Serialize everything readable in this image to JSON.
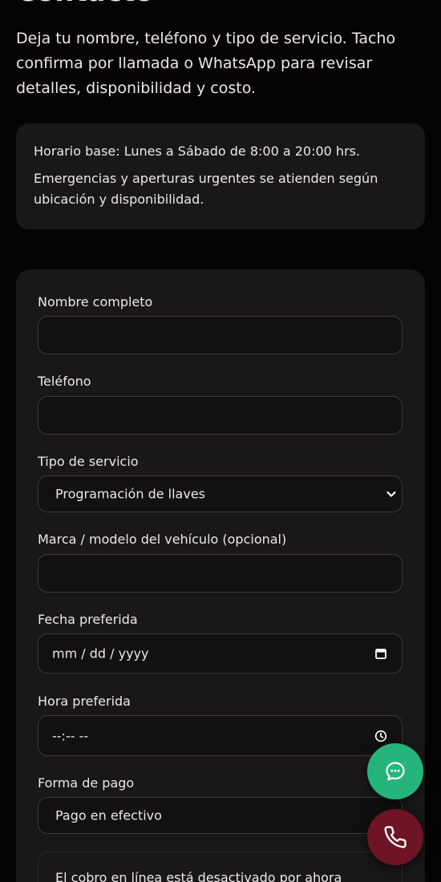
{
  "page": {
    "heading_fragment": "Contacto",
    "intro": "Deja tu nombre, teléfono y tipo de servicio. Tacho confirma por llamada o WhatsApp para revisar detalles, disponibilidad y costo."
  },
  "hours": {
    "base": "Horario base: Lunes a Sábado de 8:00 a 20:00 hrs.",
    "emergency": "Emergencias y aperturas urgentes se atienden según ubicación y disponibilidad."
  },
  "form": {
    "name_label": "Nombre completo",
    "name_value": "",
    "phone_label": "Teléfono",
    "phone_value": "",
    "service_label": "Tipo de servicio",
    "service_selected": "Programación de llaves",
    "vehicle_label": "Marca / modelo del vehículo (opcional)",
    "vehicle_value": "",
    "date_label": "Fecha preferida",
    "date_placeholder": "mm / dd / yyyy",
    "time_label": "Hora preferida",
    "time_placeholder": "--:-- --",
    "payment_label": "Forma de pago",
    "payment_selected": "Pago en efectivo",
    "online_notice": "El cobro en línea está desactivado por ahora"
  },
  "fabs": {
    "whatsapp_icon": "whatsapp-chat-icon",
    "call_icon": "phone-icon",
    "whatsapp_color": "#25b57a",
    "call_color": "#6e1424"
  },
  "colors": {
    "background": "#060305",
    "card": "#191719",
    "field": "#121012",
    "border": "#3e3a3d"
  }
}
